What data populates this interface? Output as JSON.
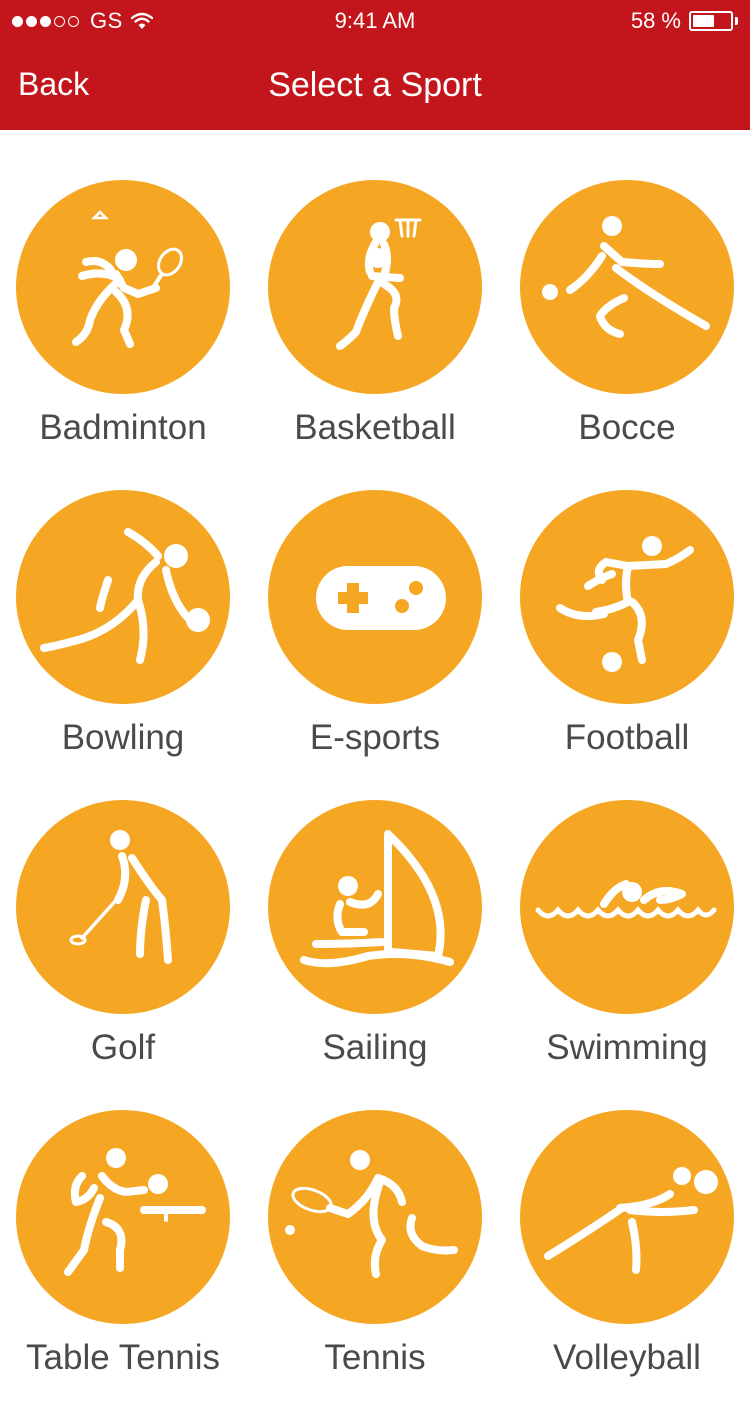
{
  "status_bar": {
    "carrier": "GS",
    "time": "9:41 AM",
    "battery": "58 %",
    "battery_level": 0.58,
    "signal_strength": 3
  },
  "nav": {
    "back_label": "Back",
    "title": "Select a Sport"
  },
  "theme": {
    "header_color": "#c3161c",
    "icon_color": "#f5a724",
    "label_color": "#4a4a4a"
  },
  "sports": [
    {
      "label": "Badminton",
      "icon": "badminton-icon"
    },
    {
      "label": "Basketball",
      "icon": "basketball-icon"
    },
    {
      "label": "Bocce",
      "icon": "bocce-icon"
    },
    {
      "label": "Bowling",
      "icon": "bowling-icon"
    },
    {
      "label": "E-sports",
      "icon": "gamepad-icon"
    },
    {
      "label": "Football",
      "icon": "football-icon"
    },
    {
      "label": "Golf",
      "icon": "golf-icon"
    },
    {
      "label": "Sailing",
      "icon": "sailing-icon"
    },
    {
      "label": "Swimming",
      "icon": "swimming-icon"
    },
    {
      "label": "Table Tennis",
      "icon": "table-tennis-icon"
    },
    {
      "label": "Tennis",
      "icon": "tennis-icon"
    },
    {
      "label": "Volleyball",
      "icon": "volleyball-icon"
    }
  ]
}
